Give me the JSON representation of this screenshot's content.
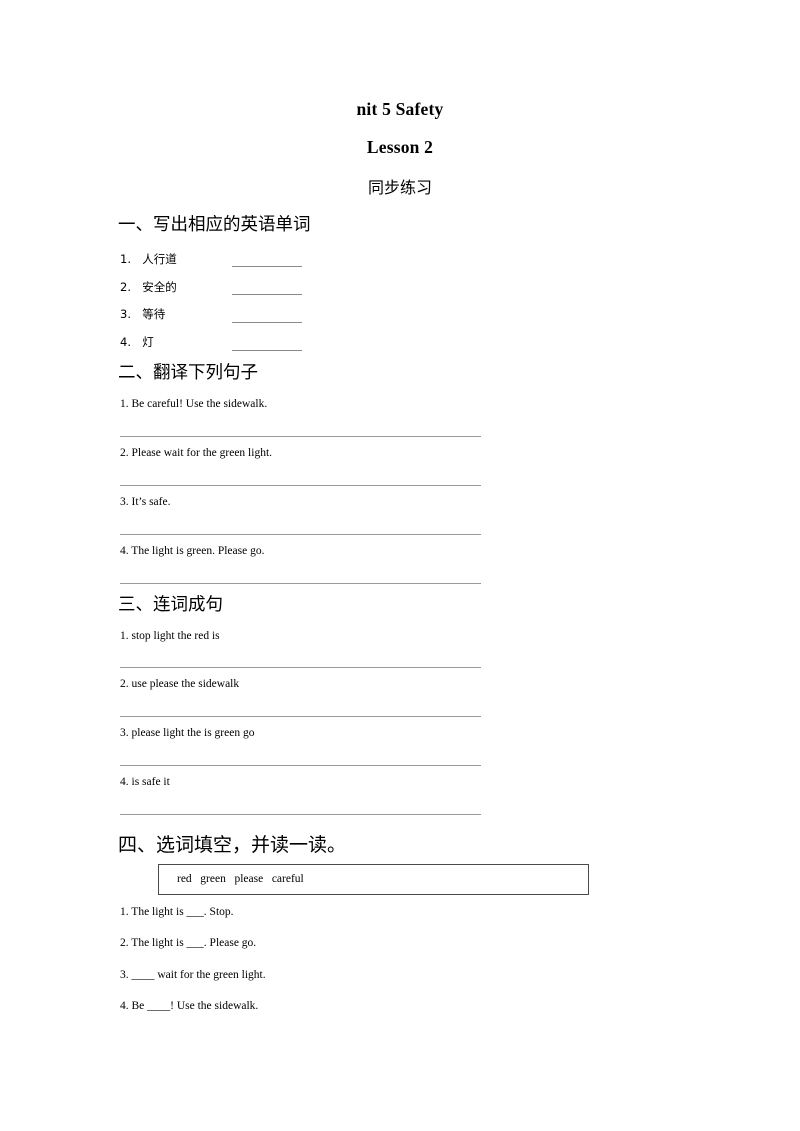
{
  "document": {
    "title_unit": "nit 5 Safety",
    "title_lesson": "Lesson 2",
    "title_subtitle": "同步练习"
  },
  "sections": [
    {
      "heading": "一、写出相应的英语单词",
      "items": [
        {
          "number": "1.",
          "text": "人行道"
        },
        {
          "number": "2.",
          "text": "安全的"
        },
        {
          "number": "3.",
          "text": "等待"
        },
        {
          "number": "4.",
          "text": "灯"
        }
      ]
    },
    {
      "heading": "二、翻译下列句子",
      "items": [
        {
          "text": "1. Be careful! Use the sidewalk."
        },
        {
          "text": "2. Please wait for the green light."
        },
        {
          "text": "3. It’s safe."
        },
        {
          "text": "4. The light is green. Please go."
        }
      ]
    },
    {
      "heading": "三、连词成句",
      "items": [
        {
          "text": "1. stop light the red is"
        },
        {
          "text": "2. use please the sidewalk"
        },
        {
          "text": "3. please light the is green go"
        },
        {
          "text": "4. is safe it"
        }
      ]
    },
    {
      "heading": "四、选词填空，并读一读。",
      "wordbank": "red   green   please   careful",
      "items": [
        {
          "text": "1. The light is ___. Stop."
        },
        {
          "text": "2. The light is ___. Please go."
        },
        {
          "text": "3. ____ wait for the green light."
        },
        {
          "text": "4. Be ____! Use the sidewalk."
        }
      ]
    }
  ]
}
